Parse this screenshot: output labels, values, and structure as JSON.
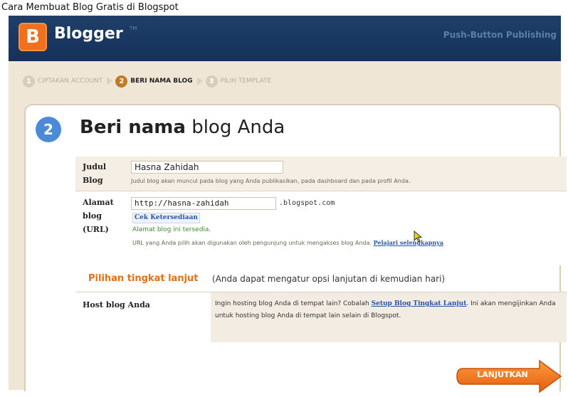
{
  "caption": "Cara Membuat Blog Gratis di Blogspot",
  "header": {
    "logo_letter": "B",
    "brand": "Blogger",
    "trademark": "TM",
    "tagline": "Push-Button Publishing"
  },
  "steps": [
    {
      "num": "1",
      "label": "CIPTAKAN ACCOUNT"
    },
    {
      "num": "2",
      "label": "BERI NAMA BLOG"
    },
    {
      "num": "3",
      "label": "PILIH TEMPLATE"
    }
  ],
  "page": {
    "step_num": "2",
    "title_bold": "Beri nama",
    "title_rest": "blog Anda"
  },
  "blog_title": {
    "label": "Judul Blog",
    "value": "Hasna Zahidah",
    "help": "Judul blog akan muncul pada blog yang Anda publikasikan, pada dashboard dan pada profil Anda."
  },
  "blog_address": {
    "label_line1": "Alamat",
    "label_line2": "blog",
    "label_line3": "(URL)",
    "prefix": "http://",
    "value": "hasna-zahidah",
    "suffix": ".blogspot.com",
    "check_link": "Cek Ketersediaan",
    "availability": "Alamat blog ini tersedia.",
    "help": "URL yang Anda pilih akan digunakan oleh pengunjung untuk mengakses blog Anda.",
    "learn_more": "Pelajari selengkapnya"
  },
  "advanced": {
    "title": "Pilihan tingkat lanjut",
    "note": "(Anda dapat mengatur opsi lanjutan di kemudian hari)"
  },
  "host": {
    "label": "Host blog Anda",
    "text_before": "Ingin hosting blog Anda di tempat lain? Cobalah",
    "link": "Setup Blog Tingkat Lanjut",
    "text_after": ". Ini akan mengijinkan Anda untuk hosting blog Anda di tempat lain selain di Blogspot."
  },
  "next_button": "LANJUTKAN",
  "colors": {
    "header_bg": "#1a3a63",
    "accent_orange": "#f0701c",
    "step_blue": "#4a8ad8",
    "link_blue": "#2a53a6"
  }
}
